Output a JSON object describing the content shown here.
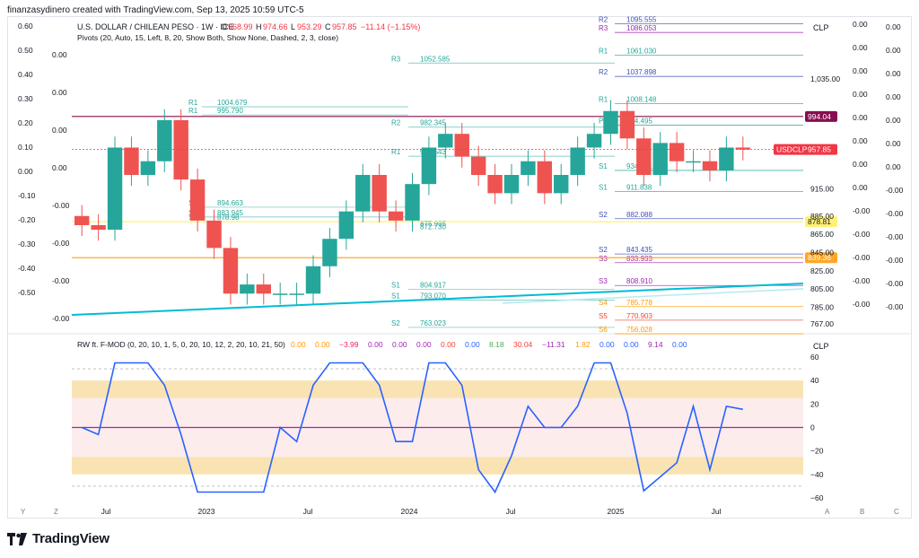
{
  "header": {
    "caption": "finanzasydinero created with TradingView.com, Sep 13, 2025 10:59 UTC-5"
  },
  "symbol": {
    "title": "U.S. DOLLAR / CHILEAN PESO · 1W · ICE",
    "o_label": "O",
    "o": "968.99",
    "h_label": "H",
    "h": "974.66",
    "l_label": "L",
    "l": "953.29",
    "c_label": "C",
    "c": "957.85",
    "chg": "−11.14 (−1.15%)",
    "pivots_legend": "Pivots (20, Auto, 15, Left, 8, 20, Show Both, Show None, Dashed, 2, 3, close)"
  },
  "price_axis": {
    "currency": "CLP",
    "ticks": [
      "1,035.00",
      "915.00",
      "885.00",
      "865.00",
      "845.00",
      "825.00",
      "805.00",
      "785.00",
      "767.00"
    ],
    "last_label": "USDCLP",
    "last_value": "957.85",
    "tags": [
      {
        "value": "994.04",
        "color": "#880e4f"
      },
      {
        "value": "878.81",
        "color": "#fff176"
      },
      {
        "value": "839.36",
        "color": "#ffa726"
      }
    ]
  },
  "pivot_levels": [
    {
      "name": "R2",
      "value": "1095.555",
      "color": "#3f51b5"
    },
    {
      "name": "R3",
      "value": "1086.053",
      "color": "#9c27b0"
    },
    {
      "name": "R1",
      "value": "1061.030",
      "color": "#26a69a"
    },
    {
      "name": "R2",
      "value": "1037.898",
      "color": "#3f51b5"
    },
    {
      "name": "R1",
      "value": "1008.148",
      "color": "#26a69a"
    },
    {
      "name": "P",
      "value": "984.495",
      "color": "#26a69a"
    },
    {
      "name": "S1",
      "value": "934.951",
      "color": "#26a69a"
    },
    {
      "name": "S1",
      "value": "911.838",
      "color": "#26a69a"
    },
    {
      "name": "S2",
      "value": "882.088",
      "color": "#3f51b5"
    },
    {
      "name": "S2",
      "value": "843.435",
      "color": "#3f51b5"
    },
    {
      "name": "S3",
      "value": "833.933",
      "color": "#9c27b0"
    },
    {
      "name": "S3",
      "value": "808.910",
      "color": "#9c27b0"
    },
    {
      "name": "S4",
      "value": "785.778",
      "color": "#ff9800"
    },
    {
      "name": "S5",
      "value": "770.903",
      "color": "#f44336"
    },
    {
      "name": "S6",
      "value": "756.028",
      "color": "#ff9800"
    }
  ],
  "pivot_levels_mid": [
    {
      "name": "R3",
      "value": "1052.585"
    },
    {
      "name": "R2",
      "value": "982.345"
    },
    {
      "name": "R1",
      "value": "950.543"
    },
    {
      "name": "S1",
      "value": "804.917"
    },
    {
      "name": "S1",
      "value": "793.070"
    },
    {
      "name": "S2",
      "value": "763.023"
    }
  ],
  "pivot_levels_left": [
    {
      "name": "R1",
      "value": "1004.679"
    },
    {
      "name": "R1",
      "value": "995.790"
    },
    {
      "name": "S1",
      "value": "894.663"
    },
    {
      "name": "S1",
      "value": "883.945"
    },
    {
      "name": "S1",
      "value": "878.98"
    }
  ],
  "mid_extra": [
    "875.995",
    "872.730"
  ],
  "left_axis": {
    "ticks": [
      "0.60",
      "0.50",
      "0.40",
      "0.30",
      "0.20",
      "0.10",
      "0.00",
      "-0.10",
      "-0.20",
      "-0.30",
      "-0.40",
      "-0.50"
    ]
  },
  "left_axis2": {
    "ticks": [
      "0.00",
      "0.00",
      "0.00",
      "0.00",
      "-0.00",
      "-0.00",
      "-0.00",
      "-0.00"
    ]
  },
  "right_axis_a": {
    "ticks": [
      "0.00",
      "0.00",
      "0.00",
      "0.00",
      "0.00",
      "0.00",
      "0.00",
      "0.00",
      "-0.00",
      "-0.00",
      "-0.00",
      "-0.00",
      "-0.00"
    ]
  },
  "right_axis_b": {
    "ticks": [
      "0.00",
      "0.00",
      "0.00",
      "0.00",
      "0.00",
      "0.00",
      "0.00",
      "-0.00",
      "-0.00",
      "-0.00",
      "-0.00",
      "-0.00",
      "-0.00"
    ]
  },
  "indicator": {
    "title": "RW ft. F-MOD (0, 20, 10, 1, 5, 0, 20, 10, 12, 2, 20, 10, 21, 50)",
    "values": [
      {
        "v": "0.00",
        "c": "#ff9800"
      },
      {
        "v": "0.00",
        "c": "#ff9800"
      },
      {
        "v": "−3.99",
        "c": "#e91e63"
      },
      {
        "v": "0.00",
        "c": "#9c27b0"
      },
      {
        "v": "0.00",
        "c": "#9c27b0"
      },
      {
        "v": "0.00",
        "c": "#9c27b0"
      },
      {
        "v": "0.00",
        "c": "#f44336"
      },
      {
        "v": "0.00",
        "c": "#2962ff"
      },
      {
        "v": "8.18",
        "c": "#4caf50"
      },
      {
        "v": "30.04",
        "c": "#f44336"
      },
      {
        "v": "−11.31",
        "c": "#9c27b0"
      },
      {
        "v": "1.82",
        "c": "#ff9800"
      },
      {
        "v": "0.00",
        "c": "#2962ff"
      },
      {
        "v": "0.00",
        "c": "#2962ff"
      },
      {
        "v": "9.14",
        "c": "#9c27b0"
      },
      {
        "v": "0.00",
        "c": "#2962ff"
      }
    ],
    "currency": "CLP",
    "ticks": [
      "60",
      "40",
      "20",
      "0",
      "−20",
      "−40",
      "−60"
    ]
  },
  "time_axis": {
    "labels": [
      "Jul",
      "2023",
      "Jul",
      "2024",
      "Jul",
      "2025",
      "Jul"
    ]
  },
  "corner_labels": {
    "y": "Y",
    "z": "Z",
    "a": "A",
    "b": "B",
    "c": "C"
  },
  "brand": {
    "name": "TradingView"
  },
  "chart_data": {
    "type": "candlestick",
    "title": "U.S. DOLLAR / CHILEAN PESO · 1W · ICE",
    "ylim": [
      760,
      1100
    ],
    "x": [
      "2022-05",
      "2022-06",
      "2022-07",
      "2022-08",
      "2022-09",
      "2022-10",
      "2022-11",
      "2022-12",
      "2023-01",
      "2023-02",
      "2023-03",
      "2023-04",
      "2023-05",
      "2023-06",
      "2023-07",
      "2023-08",
      "2023-09",
      "2023-10",
      "2023-11",
      "2023-12",
      "2024-01",
      "2024-02",
      "2024-03",
      "2024-04",
      "2024-05",
      "2024-06",
      "2024-07",
      "2024-08",
      "2024-09",
      "2024-10",
      "2024-11",
      "2024-12",
      "2025-01",
      "2025-02",
      "2025-03",
      "2025-04",
      "2025-05",
      "2025-06",
      "2025-07",
      "2025-08",
      "2025-09"
    ],
    "close": [
      875,
      870,
      960,
      930,
      945,
      990,
      925,
      880,
      850,
      800,
      810,
      800,
      800,
      800,
      830,
      860,
      890,
      930,
      890,
      880,
      920,
      960,
      975,
      950,
      930,
      910,
      930,
      945,
      910,
      930,
      960,
      975,
      1000,
      970,
      930,
      965,
      945,
      945,
      935,
      960,
      957.85
    ],
    "indicator_ylim": [
      -60,
      60
    ]
  }
}
